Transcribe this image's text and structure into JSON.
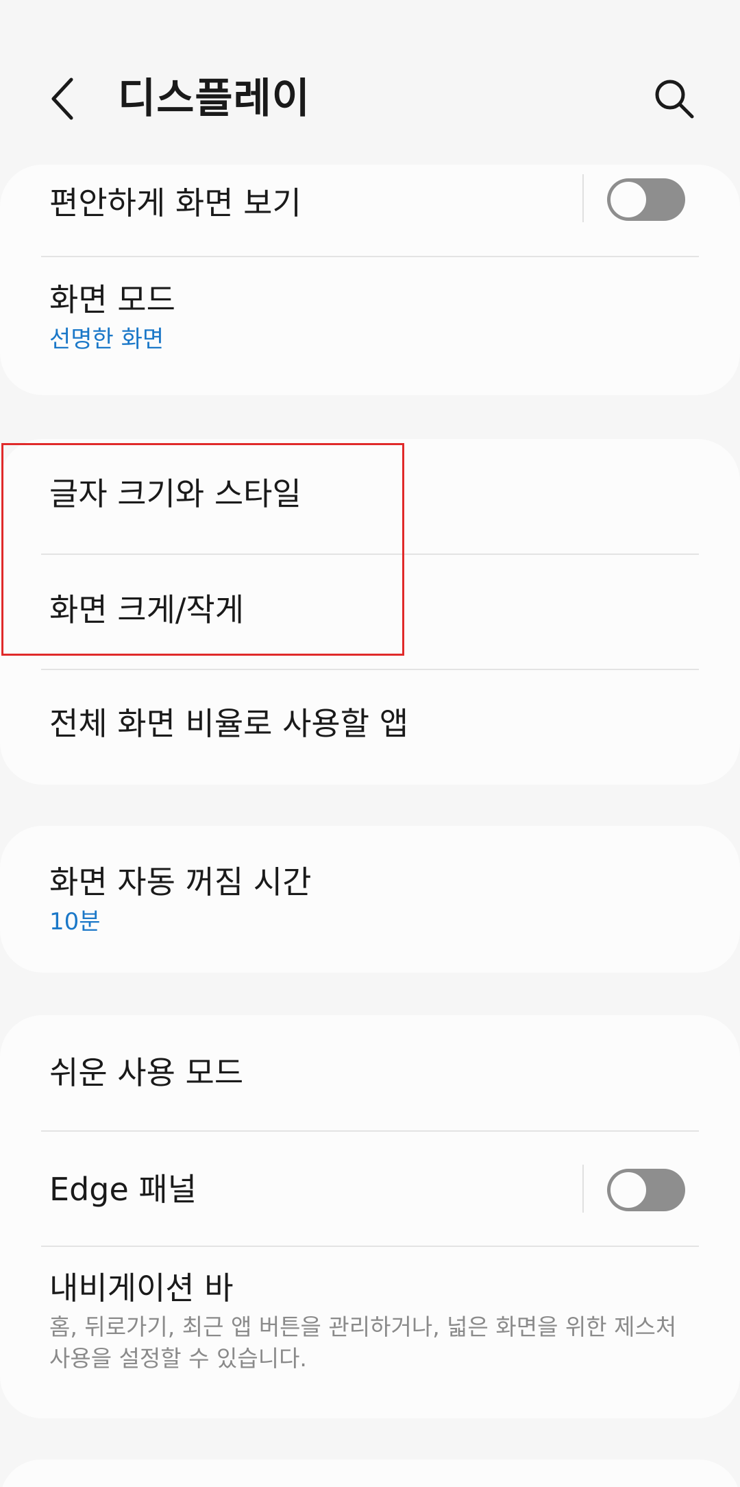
{
  "header": {
    "title": "디스플레이",
    "back_icon": "chevron-left-icon",
    "search_icon": "search-icon"
  },
  "cards": {
    "comfort": {
      "eye_comfort_label": "편안하게 화면 보기",
      "eye_comfort_on": false,
      "screen_mode_label": "화면 모드",
      "screen_mode_value": "선명한 화면"
    },
    "text": {
      "font_size_label": "글자 크기와 스타일",
      "screen_zoom_label": "화면 크게/작게",
      "fullscreen_apps_label": "전체 화면 비율로 사용할 앱"
    },
    "timeout": {
      "label": "화면 자동 꺼짐 시간",
      "value": "10분"
    },
    "misc": {
      "easy_mode_label": "쉬운 사용 모드",
      "edge_panels_label": "Edge 패널",
      "edge_panels_on": false,
      "navigation_bar_label": "내비게이션 바",
      "navigation_bar_desc": "홈, 뒤로가기, 최근 앱 버튼을 관리하거나, 넓은 화면을 위한 제스처 사용을 설정할 수 있습니다."
    }
  },
  "colors": {
    "accent_blue": "#1b78c8",
    "highlight_red": "#e02a2a",
    "toggle_off": "#8e8e8e"
  }
}
